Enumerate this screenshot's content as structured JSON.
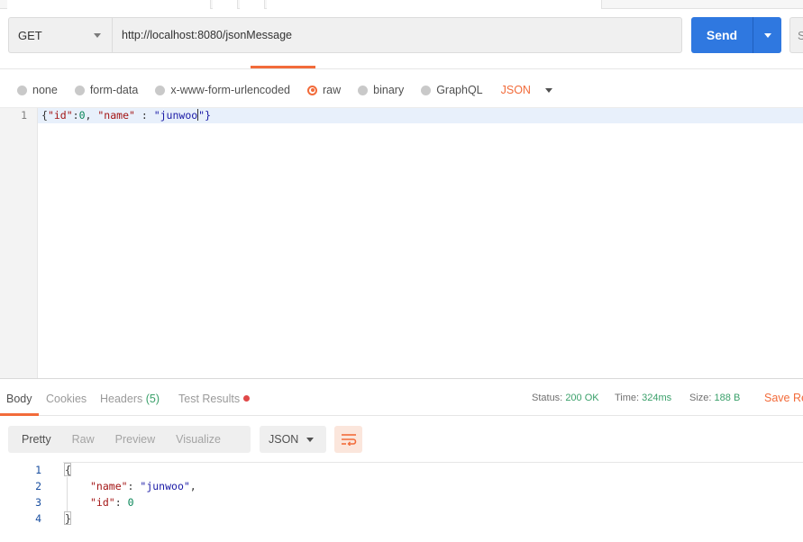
{
  "request": {
    "method": "GET",
    "url": "http://localhost:8080/jsonMessage",
    "send_label": "Send",
    "save_label_partial": "S"
  },
  "body_types": [
    {
      "label": "none",
      "selected": false
    },
    {
      "label": "form-data",
      "selected": false
    },
    {
      "label": "x-www-form-urlencoded",
      "selected": false
    },
    {
      "label": "raw",
      "selected": true
    },
    {
      "label": "binary",
      "selected": false
    },
    {
      "label": "GraphQL",
      "selected": false
    }
  ],
  "body_format": "JSON",
  "editor": {
    "line_number": "1",
    "p1": "{",
    "p2": "\"id\"",
    "p3": ":",
    "p4": "0",
    "p5": ", ",
    "p6": "\"name\"",
    "p7": " : ",
    "p8": "\"junwoo",
    "p9": "\"}"
  },
  "response": {
    "tabs": {
      "body": "Body",
      "cookies": "Cookies",
      "headers": "Headers",
      "headers_count": "(5)",
      "test_results": "Test Results"
    },
    "status_label": "Status:",
    "status_value": "200 OK",
    "time_label": "Time:",
    "time_value": "324ms",
    "size_label": "Size:",
    "size_value": "188 B",
    "save_response": "Save Re",
    "format_tabs": [
      "Pretty",
      "Raw",
      "Preview",
      "Visualize"
    ],
    "language": "JSON",
    "lines": {
      "n1": "1",
      "n2": "2",
      "n3": "3",
      "n4": "4",
      "l1": "{",
      "l2_key": "\"name\"",
      "l2_sep": ": ",
      "l2_val": "\"junwoo\"",
      "l2_end": ",",
      "l3_key": "\"id\"",
      "l3_sep": ": ",
      "l3_val": "0",
      "l4": "}"
    }
  },
  "colors": {
    "accent": "#f26b3a",
    "send": "#2f78e0",
    "status_ok": "#3aa06a"
  }
}
